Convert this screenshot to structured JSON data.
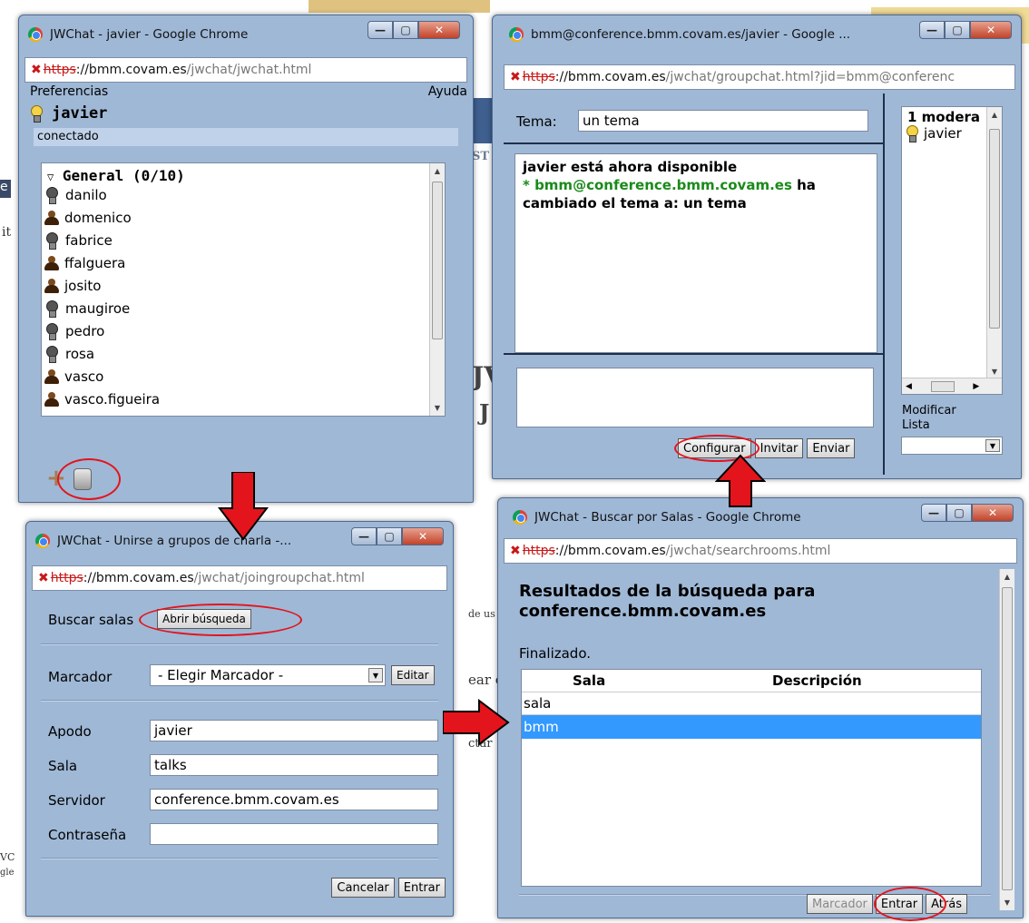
{
  "background": {
    "fragments": [
      "e",
      "it",
      "VC",
      "gle",
      "JV",
      "J",
      "de us",
      "ear e",
      "ctar",
      "ST"
    ]
  },
  "win1": {
    "title": "JWChat - javier - Google Chrome",
    "url_https": "https",
    "url_host": "://bmm.covam.es",
    "url_path": "/jwchat/jwchat.html",
    "menu_left": "Preferencias",
    "menu_right": "Ayuda",
    "user": "javier",
    "status": "conectado",
    "group_label": "General (0/10)",
    "contacts": [
      {
        "name": "danilo",
        "icon": "bulb-offline-icon"
      },
      {
        "name": "domenico",
        "icon": "user-icon"
      },
      {
        "name": "fabrice",
        "icon": "bulb-offline-icon"
      },
      {
        "name": "ffalguera",
        "icon": "user-icon"
      },
      {
        "name": "josito",
        "icon": "user-icon"
      },
      {
        "name": "maugiroe",
        "icon": "bulb-offline-icon"
      },
      {
        "name": "pedro",
        "icon": "bulb-offline-icon"
      },
      {
        "name": "rosa",
        "icon": "bulb-offline-icon"
      },
      {
        "name": "vasco",
        "icon": "user-icon"
      },
      {
        "name": "vasco.figueira",
        "icon": "user-icon"
      }
    ]
  },
  "win2": {
    "title": "bmm@conference.bmm.covam.es/javier - Google ...",
    "url_https": "https",
    "url_host": "://bmm.covam.es",
    "url_path": "/jwchat/groupchat.html?jid=bmm@conferenc",
    "tema_label": "Tema:",
    "tema_value": "un tema",
    "msg1": "javier está ahora disponible",
    "msg2_prefix": "* bmm@conference.bmm.covam.es",
    "msg2_suffix": " ha",
    "msg3": "cambiado el tema a: un tema",
    "roster_header": "1 modera",
    "roster_user": "javier",
    "btn_configurar": "Configurar",
    "btn_invitar": "Invitar",
    "btn_enviar": "Enviar",
    "modificar": "Modificar",
    "lista": "Lista"
  },
  "win3": {
    "title": "JWChat - Unirse a grupos de charla -...",
    "url_https": "https",
    "url_host": "://bmm.covam.es",
    "url_path": "/jwchat/joingroupchat.html",
    "buscar_label": "Buscar salas",
    "btn_abrir": "Abrir búsqueda",
    "marcador_label": "Marcador",
    "marcador_value": "- Elegir Marcador -",
    "btn_editar": "Editar",
    "apodo_label": "Apodo",
    "apodo_value": "javier",
    "sala_label": "Sala",
    "sala_value": "talks",
    "servidor_label": "Servidor",
    "servidor_value": "conference.bmm.covam.es",
    "pass_label": "Contraseña",
    "pass_value": "",
    "btn_cancelar": "Cancelar",
    "btn_entrar": "Entrar"
  },
  "win4": {
    "title": "JWChat - Buscar por Salas - Google Chrome",
    "url_https": "https",
    "url_host": "://bmm.covam.es",
    "url_path": "/jwchat/searchrooms.html",
    "heading_line1": "Resultados de la búsqueda para",
    "heading_line2": "conference.bmm.covam.es",
    "status": "Finalizado.",
    "col_sala": "Sala",
    "col_desc": "Descripción",
    "rows": [
      {
        "sala": "sala",
        "desc": ""
      },
      {
        "sala": "bmm",
        "desc": ""
      }
    ],
    "btn_marcador": "Marcador",
    "btn_entrar": "Entrar",
    "btn_atras": "Atrás"
  },
  "colors": {
    "window_bg": "#9fb8d6",
    "annotation_red": "#e3141c",
    "selected_row": "#3399ff",
    "nick_green": "#1a8a1a"
  }
}
